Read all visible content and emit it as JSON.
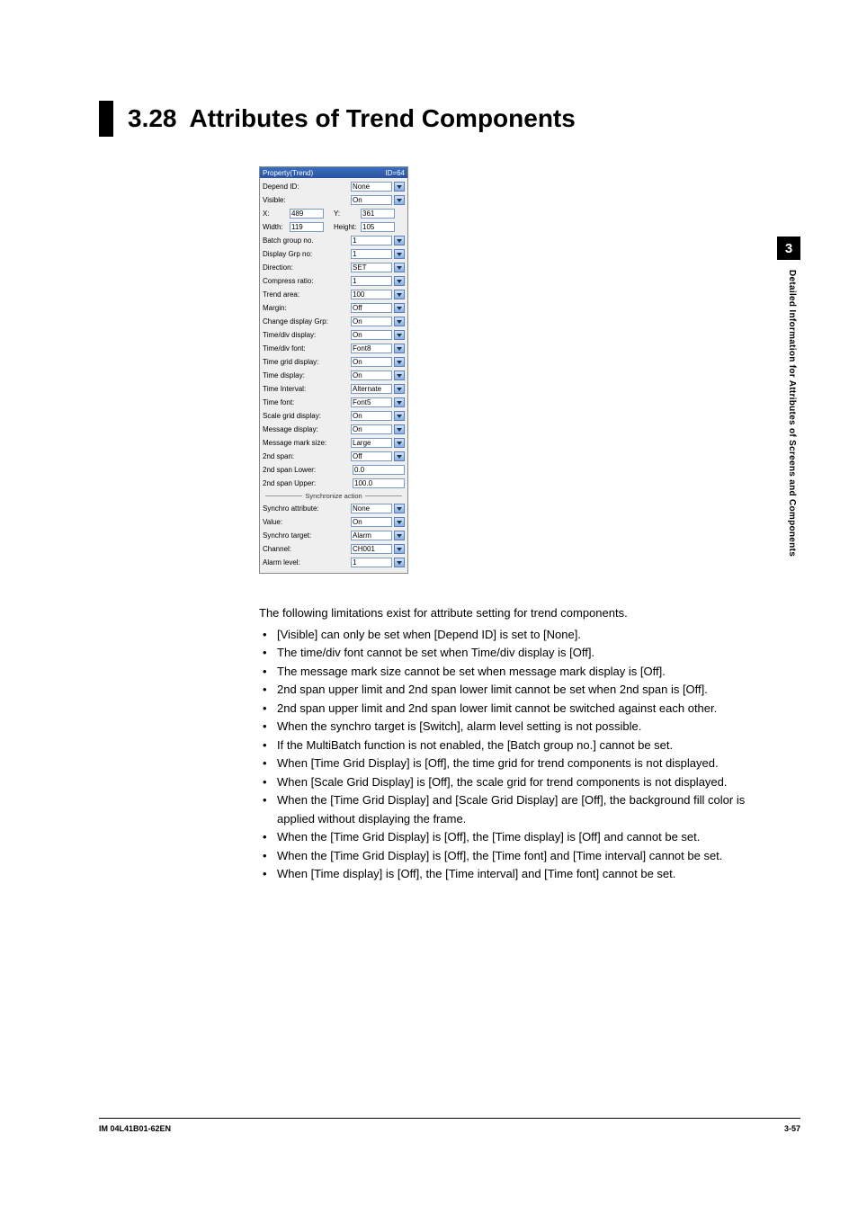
{
  "heading": {
    "number": "3.28",
    "title": "Attributes of Trend Components"
  },
  "side": {
    "chapter": "3",
    "label": "Detailed Information for Attributes of Screens and Components"
  },
  "panel": {
    "title": "Property(Trend)",
    "id_label": "ID=64",
    "rows": {
      "dependId_label": "Depend ID:",
      "dependId_value": "None",
      "visible_label": "Visible:",
      "visible_value": "On",
      "x_label": "X:",
      "x_value": "489",
      "y_label": "Y:",
      "y_value": "361",
      "width_label": "Width:",
      "width_value": "119",
      "height_label": "Height:",
      "height_value": "105",
      "batchGroup_label": "Batch group no.",
      "batchGroup_value": "1",
      "displayGrp_label": "Display Grp no:",
      "displayGrp_value": "1",
      "direction_label": "Direction:",
      "direction_value": "SET",
      "compress_label": "Compress ratio:",
      "compress_value": "1",
      "trendArea_label": "Trend area:",
      "trendArea_value": "100",
      "margin_label": "Margin:",
      "margin_value": "Off",
      "changeDisp_label": "Change display Grp:",
      "changeDisp_value": "On",
      "timeDivDisp_label": "Time/div display:",
      "timeDivDisp_value": "On",
      "timeDivFont_label": "Time/div font:",
      "timeDivFont_value": "Font8",
      "timeGridDisp_label": "Time grid display:",
      "timeGridDisp_value": "On",
      "timeDisp_label": "Time display:",
      "timeDisp_value": "On",
      "timeInterval_label": "Time Interval:",
      "timeInterval_value": "Alternate",
      "timeFont_label": "Time font:",
      "timeFont_value": "Font5",
      "scaleGridDisp_label": "Scale grid display:",
      "scaleGridDisp_value": "On",
      "msgDisp_label": "Message display:",
      "msgDisp_value": "On",
      "msgMarkSize_label": "Message mark size:",
      "msgMarkSize_value": "Large",
      "span2_label": "2nd span:",
      "span2_value": "Off",
      "span2Lower_label": "2nd span Lower:",
      "span2Lower_value": "0.0",
      "span2Upper_label": "2nd span Upper:",
      "span2Upper_value": "100.0",
      "syncSection": "Synchronize action",
      "syncAttr_label": "Synchro attribute:",
      "syncAttr_value": "None",
      "value_label": "Value:",
      "value_value": "On",
      "syncTarget_label": "Synchro target:",
      "syncTarget_value": "Alarm",
      "channel_label": "Channel:",
      "channel_value": "CH001",
      "alarmLevel_label": "Alarm level:",
      "alarmLevel_value": "1"
    }
  },
  "body": {
    "intro": "The following limitations exist for attribute setting for trend components.",
    "bullets": [
      "[Visible] can only be set when [Depend ID] is set to [None].",
      "The time/div font cannot be set when Time/div display is [Off].",
      "The message mark size cannot be set when message mark display is [Off].",
      "2nd span upper limit and 2nd span lower limit cannot be set when 2nd span is [Off].",
      "2nd span upper limit and 2nd span lower limit cannot be switched against each other.",
      "When the synchro target is [Switch], alarm level setting is not possible.",
      "If the MultiBatch function is not enabled, the [Batch group no.] cannot be set.",
      "When [Time Grid Display] is [Off], the time grid for trend components is not displayed.",
      "When [Scale Grid Display] is [Off], the scale grid for trend components is not displayed.",
      "When the [Time Grid Display] and [Scale Grid Display] are [Off], the background fill color is applied without displaying the frame.",
      "When the [Time Grid Display] is [Off], the [Time display] is [Off] and cannot be set.",
      "When the [Time Grid Display] is [Off], the [Time font] and [Time interval] cannot be set.",
      "When [Time display] is [Off], the [Time interval] and [Time font] cannot be set."
    ]
  },
  "footer": {
    "left": "IM 04L41B01-62EN",
    "right": "3-57"
  }
}
